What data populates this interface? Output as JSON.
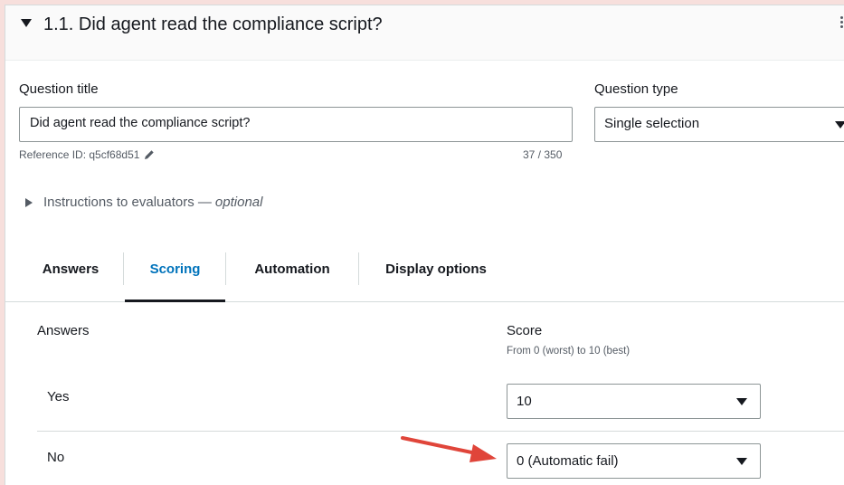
{
  "question": {
    "header_title": "1.1. Did agent read the compliance script?",
    "title_label": "Question title",
    "title_value": "Did agent read the compliance script?",
    "type_label": "Question type",
    "type_value": "Single selection",
    "reference_id": "Reference ID: q5cf68d51",
    "char_count": "37 / 350",
    "instructions_label": "Instructions to evaluators —",
    "instructions_optional": "optional"
  },
  "tabs": [
    {
      "label": "Answers",
      "active": false
    },
    {
      "label": "Scoring",
      "active": true
    },
    {
      "label": "Automation",
      "active": false
    },
    {
      "label": "Display options",
      "active": false
    }
  ],
  "scoring": {
    "answers_header": "Answers",
    "score_header": "Score",
    "score_range": "From 0 (worst) to 10 (best)",
    "rows": [
      {
        "answer": "Yes",
        "score": "10"
      },
      {
        "answer": "No",
        "score": "0 (Automatic fail)"
      }
    ]
  },
  "colors": {
    "accent": "#0073bb",
    "arrow": "#e0453a",
    "page_background": "#f7dfdc"
  },
  "icons": [
    "caret-down-icon",
    "more-options-icon",
    "pencil-icon",
    "caret-right-icon",
    "dropdown-caret-icon",
    "red-arrow-annotation"
  ]
}
